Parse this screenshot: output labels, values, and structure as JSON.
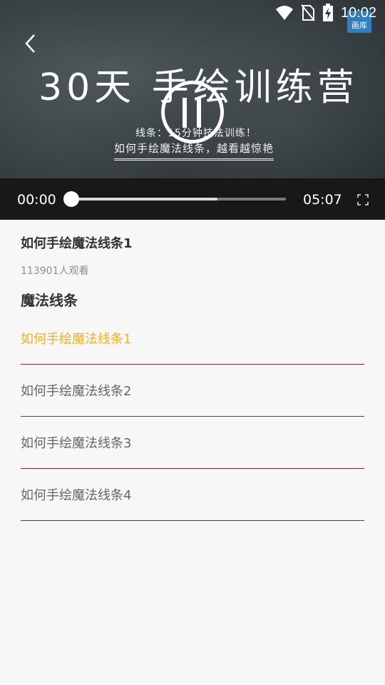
{
  "status_bar": {
    "time": "10:02",
    "icons": [
      "wifi-icon",
      "no-sim-icon",
      "battery-charging-icon"
    ]
  },
  "video": {
    "badge": "画库",
    "title": "30天 手绘训练营",
    "line1": "线条：15分钟技法训练！",
    "line2": "如何手绘魔法线条，越看越惊艳",
    "current_time": "00:00",
    "duration": "05:07",
    "progress": 0,
    "buffered": 0.68
  },
  "course": {
    "title": "如何手绘魔法线条1",
    "view_count": "113901人观看",
    "section_title": "魔法线条",
    "episodes": [
      {
        "label": "如何手绘魔法线条1",
        "active": true
      },
      {
        "label": "如何手绘魔法线条2",
        "active": false
      },
      {
        "label": "如何手绘魔法线条3",
        "active": false
      },
      {
        "label": "如何手绘魔法线条4",
        "active": false
      }
    ]
  },
  "colors": {
    "accent_active": "#f3b215",
    "divider": "#8b2a2a",
    "badge": "#2f7fc2"
  }
}
